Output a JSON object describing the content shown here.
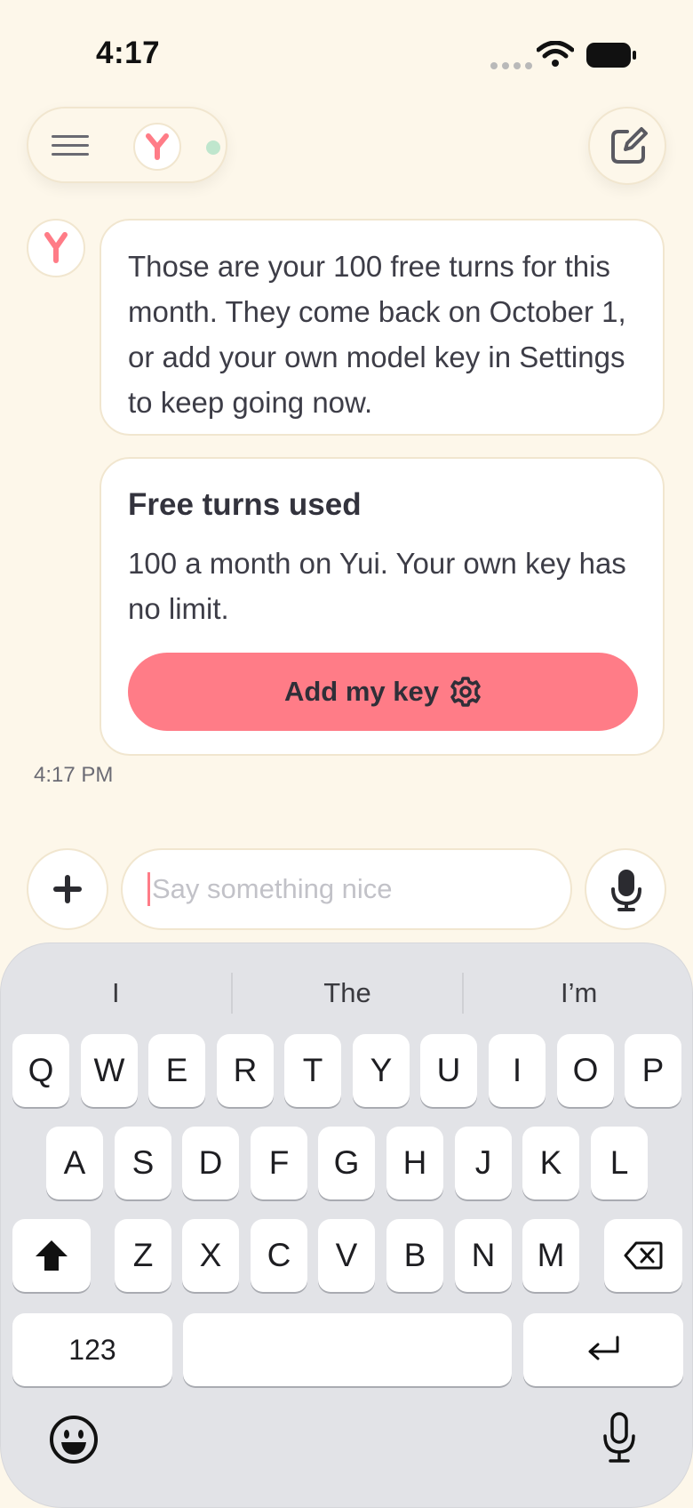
{
  "status_bar": {
    "time": "4:17"
  },
  "header": {
    "menu_icon": "hamburger-icon",
    "avatar_icon": "yui-logo-icon",
    "compose_icon": "compose-icon"
  },
  "messages": [
    {
      "sender": "Yui",
      "text": "Those are your 100 free turns for this month. They come back on October 1, or add your own model key in Settings to keep going now."
    }
  ],
  "limit_card": {
    "title": "Free turns used",
    "body": "100 a month on Yui. Your own key has no limit.",
    "button_label": "Add my key",
    "button_icon": "gear-icon"
  },
  "timestamp": "4:17 PM",
  "composer": {
    "placeholder": "Say something nice",
    "value": ""
  },
  "keyboard": {
    "suggestions": [
      "I",
      "The",
      "I’m"
    ],
    "row1": [
      "Q",
      "W",
      "E",
      "R",
      "T",
      "Y",
      "U",
      "I",
      "O",
      "P"
    ],
    "row2": [
      "A",
      "S",
      "D",
      "F",
      "G",
      "H",
      "J",
      "K",
      "L"
    ],
    "row3": [
      "Z",
      "X",
      "C",
      "V",
      "B",
      "N",
      "M"
    ],
    "numbers_label": "123"
  },
  "colors": {
    "accent": "#ff7c87",
    "background": "#fdf7ea",
    "online": "#bfe6cd"
  }
}
